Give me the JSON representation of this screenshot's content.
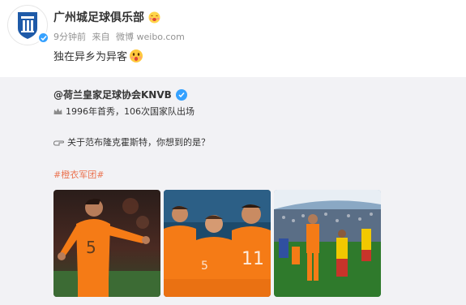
{
  "post": {
    "author": "广州城足球俱乐部",
    "time": "9分钟前",
    "source_prefix": "来自",
    "source": "微博 weibo.com",
    "text": "独在异乡为异客",
    "icons": {
      "avatar": "club-crest-icon",
      "verified": "verified-badge-icon",
      "member": "vip-emoji-icon",
      "emoji": "surprised-face-emoji"
    }
  },
  "repost": {
    "author": "@荷兰皇家足球协会KNVB",
    "line1": "1996年首秀，106次国家队出场",
    "line2": "关于范布隆克霍斯特，你想到的是？",
    "hashtag": "#橙衣军团#",
    "icons": {
      "verified": "verified-badge-icon",
      "crown": "crown-icon",
      "hand": "pointing-hand-icon"
    },
    "photos": [
      {
        "name": "celebrating-player-photo"
      },
      {
        "name": "team-celebration-photo"
      },
      {
        "name": "teams-walkout-photo"
      }
    ]
  },
  "colors": {
    "orange": "#f57b16",
    "hashtag": "#eb7350",
    "verified": "#35a1ff",
    "repost_bg": "#f2f2f5"
  }
}
